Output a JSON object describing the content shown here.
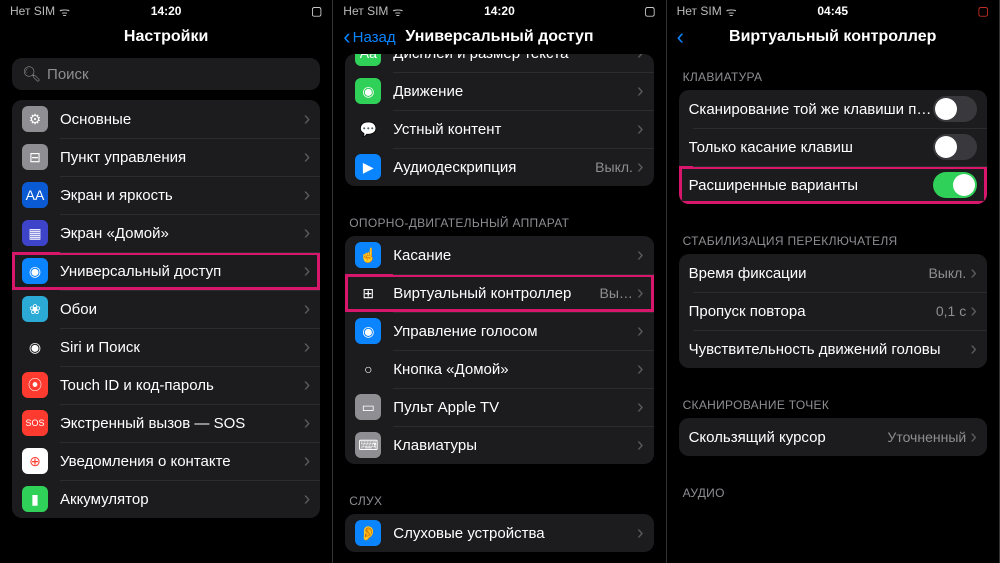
{
  "screen1": {
    "carrier": "Нет SIM",
    "time": "14:20",
    "title": "Настройки",
    "search_placeholder": "Поиск",
    "items": [
      {
        "label": "Основные",
        "color": "#8e8e93",
        "glyph": "⚙"
      },
      {
        "label": "Пункт управления",
        "color": "#8e8e93",
        "glyph": "⊟"
      },
      {
        "label": "Экран и яркость",
        "color": "#0a5bd3",
        "glyph": "AA"
      },
      {
        "label": "Экран «Домой»",
        "color": "#3e44c9",
        "glyph": "▦"
      },
      {
        "label": "Универсальный доступ",
        "color": "#0a84ff",
        "glyph": "◉",
        "hl": true
      },
      {
        "label": "Обои",
        "color": "#2aaad5",
        "glyph": "❀"
      },
      {
        "label": "Siri и Поиск",
        "color": "#1c1c1e",
        "glyph": "◉"
      },
      {
        "label": "Touch ID и код-пароль",
        "color": "#ff3b30",
        "glyph": "⦿"
      },
      {
        "label": "Экстренный вызов — SOS",
        "color": "#ff3b30",
        "glyph": "SOS"
      },
      {
        "label": "Уведомления о контакте",
        "color": "#fff",
        "glyph": "⊕",
        "fg": "#ff3b30"
      },
      {
        "label": "Аккумулятор",
        "color": "#30d158",
        "glyph": "▮"
      }
    ]
  },
  "screen2": {
    "carrier": "Нет SIM",
    "time": "14:20",
    "back": "Назад",
    "title": "Универсальный доступ",
    "group1": [
      {
        "label": "Дисплей и размер текста",
        "color": "#30d158",
        "glyph": "Aa"
      },
      {
        "label": "Движение",
        "color": "#30d158",
        "glyph": "◉"
      },
      {
        "label": "Устный контент",
        "color": "#1c1c1e",
        "glyph": "💬"
      },
      {
        "label": "Аудиодескрипция",
        "color": "#0a84ff",
        "glyph": "▶",
        "value": "Выкл."
      }
    ],
    "section2": "Опорно-двигательный аппарат",
    "group2": [
      {
        "label": "Касание",
        "color": "#0a84ff",
        "glyph": "☝"
      },
      {
        "label": "Виртуальный контроллер",
        "color": "#1c1c1e",
        "glyph": "⊞",
        "value": "Вы…",
        "hl": true
      },
      {
        "label": "Управление голосом",
        "color": "#0a84ff",
        "glyph": "◉"
      },
      {
        "label": "Кнопка «Домой»",
        "color": "#1c1c1e",
        "glyph": "○"
      },
      {
        "label": "Пульт Apple TV",
        "color": "#8e8e93",
        "glyph": "▭"
      },
      {
        "label": "Клавиатуры",
        "color": "#8e8e93",
        "glyph": "⌨"
      }
    ],
    "section3": "Слух",
    "group3": [
      {
        "label": "Слуховые устройства",
        "color": "#0a84ff",
        "glyph": "👂"
      }
    ]
  },
  "screen3": {
    "carrier": "Нет SIM",
    "time": "04:45",
    "title": "Виртуальный контроллер",
    "section1": "Клавиатура",
    "group1": [
      {
        "label": "Сканирование той же клавиши после касания",
        "toggle": "off"
      },
      {
        "label": "Только касание клавиш",
        "toggle": "off"
      },
      {
        "label": "Расширенные варианты",
        "toggle": "on",
        "hl": true
      }
    ],
    "section2": "Стабилизация переключателя",
    "group2": [
      {
        "label": "Время фиксации",
        "value": "Выкл.",
        "chev": true
      },
      {
        "label": "Пропуск повтора",
        "value": "0,1 с",
        "chev": true
      },
      {
        "label": "Чувствительность движений головы",
        "chev": true
      }
    ],
    "section3": "Сканирование точек",
    "group3": [
      {
        "label": "Скользящий курсор",
        "value": "Уточненный",
        "chev": true
      }
    ],
    "section4": "Аудио"
  }
}
